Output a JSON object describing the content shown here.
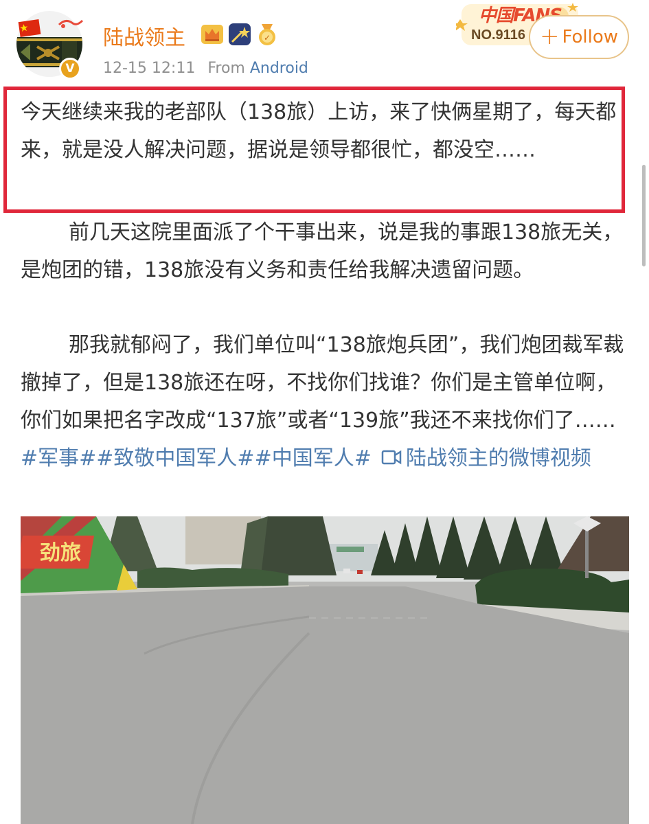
{
  "post": {
    "username": "陆战领主",
    "date": "12-15 12:11",
    "source_prefix": "From",
    "source_device": "Android",
    "verified_badge": "V",
    "title_badge_icons": [
      "crown-icon",
      "shooting-star-icon",
      "medal-icon"
    ],
    "fans_badge": {
      "title": "中国FANS",
      "number": "NO.9116"
    },
    "follow_label": "Follow",
    "follow_icon": "plus-icon",
    "paragraph1": "今天继续来我的老部队（138旅）上访，来了快俩星期了，每天都来，就是没人解决问题，据说是领导都很忙，都没空……",
    "paragraph2": "前几天这院里面派了个干事出来，说是我的事跟138旅无关，是炮团的错，138旅没有义务和责任给我解决遗留问题。",
    "paragraph3_text": "那我就郁闷了，我们单位叫“138旅炮兵团”，我们炮团裁军裁撤掉了，但是138旅还在呀，不找你们找谁？你们是主管单位啊，你们如果把名字改成“137旅”或者“139旅”我还不来找你们了……",
    "hashtags": [
      "#军事#",
      "#致敬中国军人#",
      "#中国军人#"
    ],
    "video_link": "陆战领主的微博视频",
    "photo_sign_text": "劲旅"
  },
  "colors": {
    "username": "#ea7a1b",
    "link": "#507daf",
    "highlight_border": "#e0273a",
    "follow_border": "#e8c48a",
    "meta": "#8f8f8f"
  }
}
